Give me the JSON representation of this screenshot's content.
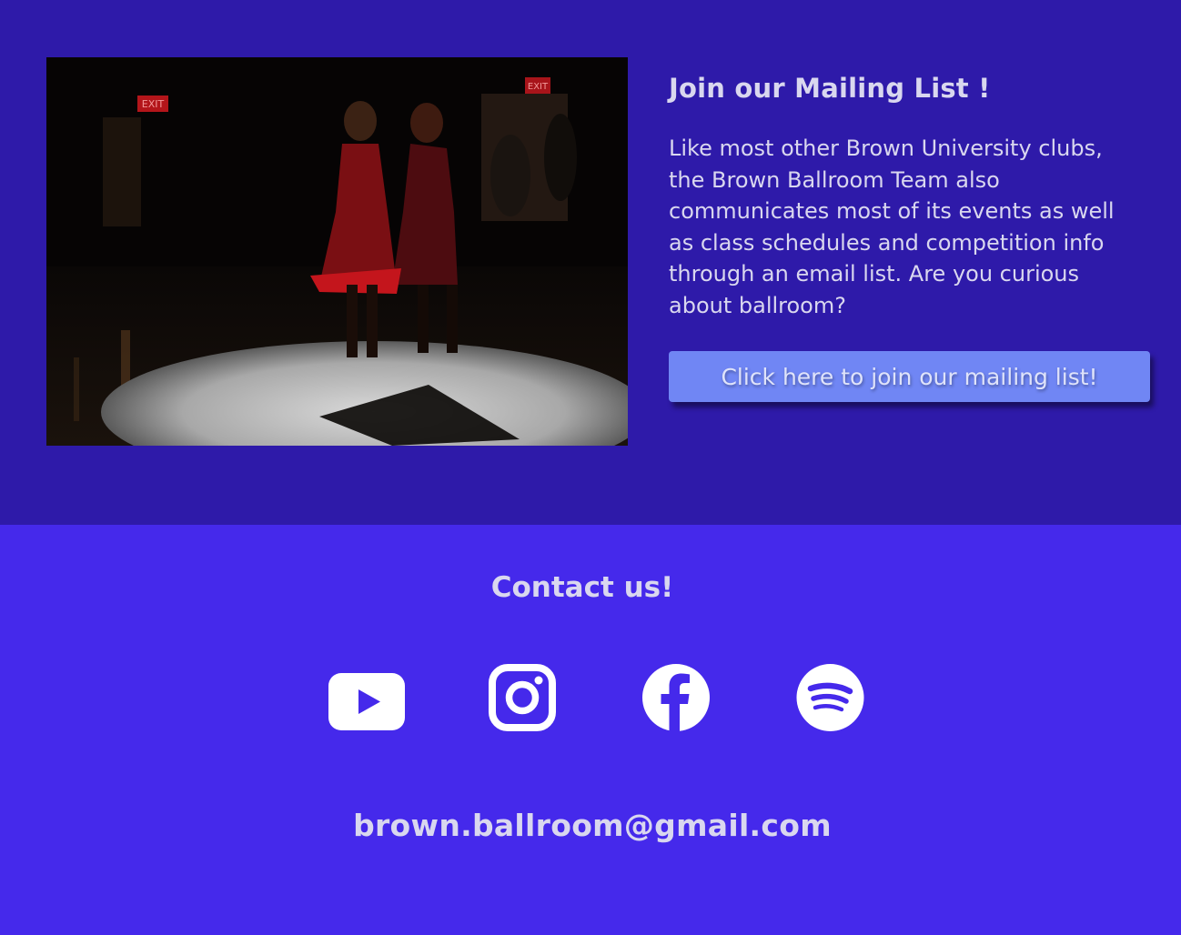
{
  "mailing": {
    "title": "Join our Mailing List !",
    "description": "Like most other Brown University clubs, the Brown Ballroom Team also communicates most of its events as well as class schedules and competition info through an email list. Are you curious about ballroom?",
    "button_label": "Click here to join our mailing list!",
    "photo_signs": [
      "EXIT",
      "EXIT"
    ]
  },
  "contact": {
    "title": "Contact us!",
    "social_icons": [
      "youtube-icon",
      "instagram-icon",
      "facebook-icon",
      "spotify-icon"
    ],
    "email": "brown.ballroom@gmail.com"
  },
  "colors": {
    "mailing_background": "#2e1aa9",
    "contact_background": "#4529eb",
    "button": "#7086f4",
    "text": "#d9d7ef",
    "icon": "#ffffff"
  }
}
